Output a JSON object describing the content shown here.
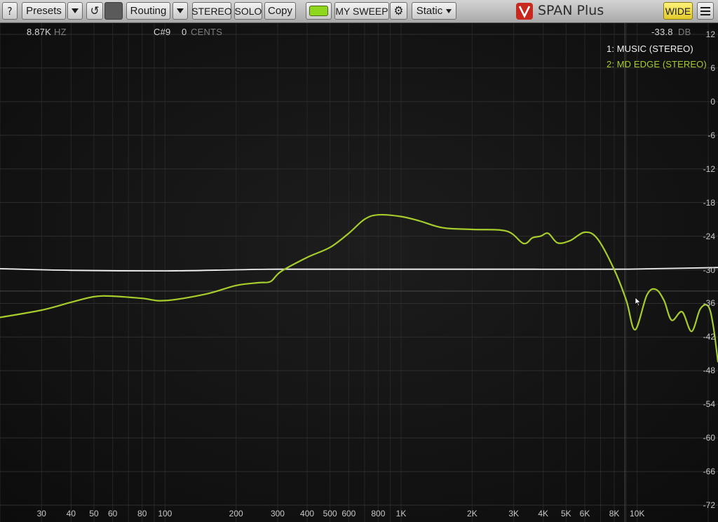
{
  "toolbar": {
    "help_label": "?",
    "presets_label": "Presets",
    "routing_label": "Routing",
    "stereo_label": "STEREO",
    "solo_label": "SOLO",
    "copy_label": "Copy",
    "sweep_label": "MY SWEEP",
    "mode_label": "Static",
    "app_title": "SPAN Plus",
    "wide_label": "WIDE",
    "enable_color": "#8fd61e"
  },
  "info": {
    "freq_value": "8.87K",
    "freq_unit": "HZ",
    "note": "C#9",
    "cents_value": "0",
    "cents_unit": "CENTS",
    "level_value": "-33.8",
    "level_unit": "DB"
  },
  "legend": [
    {
      "label": "1: MUSIC (STEREO)",
      "color": "#f2f2f2"
    },
    {
      "label": "2: MD EDGE (STEREO)",
      "color": "#a6cc2c"
    }
  ],
  "chart_data": {
    "type": "line",
    "x_scale": "log",
    "xlim": [
      20,
      22000
    ],
    "ylim": [
      -75,
      14
    ],
    "x_ticks": [
      {
        "v": 30,
        "label": "30"
      },
      {
        "v": 40,
        "label": "40"
      },
      {
        "v": 50,
        "label": "50"
      },
      {
        "v": 60,
        "label": "60"
      },
      {
        "v": 80,
        "label": "80"
      },
      {
        "v": 100,
        "label": "100"
      },
      {
        "v": 200,
        "label": "200"
      },
      {
        "v": 300,
        "label": "300"
      },
      {
        "v": 400,
        "label": "400"
      },
      {
        "v": 500,
        "label": "500"
      },
      {
        "v": 600,
        "label": "600"
      },
      {
        "v": 800,
        "label": "800"
      },
      {
        "v": 1000,
        "label": "1K"
      },
      {
        "v": 2000,
        "label": "2K"
      },
      {
        "v": 3000,
        "label": "3K"
      },
      {
        "v": 4000,
        "label": "4K"
      },
      {
        "v": 5000,
        "label": "5K"
      },
      {
        "v": 6000,
        "label": "6K"
      },
      {
        "v": 8000,
        "label": "8K"
      },
      {
        "v": 10000,
        "label": "10K"
      }
    ],
    "y_ticks": [
      {
        "v": 12,
        "label": "12"
      },
      {
        "v": 6,
        "label": "6"
      },
      {
        "v": 0,
        "label": "0"
      },
      {
        "v": -6,
        "label": "-6"
      },
      {
        "v": -12,
        "label": "-12"
      },
      {
        "v": -18,
        "label": "-18"
      },
      {
        "v": -24,
        "label": "-24"
      },
      {
        "v": -30,
        "label": "-30"
      },
      {
        "v": -36,
        "label": "-36"
      },
      {
        "v": -42,
        "label": "-42"
      },
      {
        "v": -48,
        "label": "-48"
      },
      {
        "v": -54,
        "label": "-54"
      },
      {
        "v": -60,
        "label": "-60"
      },
      {
        "v": -66,
        "label": "-66"
      },
      {
        "v": -72,
        "label": "-72"
      }
    ],
    "marker_level": -33.8,
    "cursor_freq": 8870,
    "series": [
      {
        "name": "1: MUSIC (STEREO)",
        "color": "#f2f2f2",
        "points": [
          [
            20,
            -29.8
          ],
          [
            40,
            -30.1
          ],
          [
            100,
            -30.2
          ],
          [
            200,
            -30.0
          ],
          [
            300,
            -29.9
          ],
          [
            1000,
            -29.9
          ],
          [
            3000,
            -29.9
          ],
          [
            8000,
            -29.9
          ],
          [
            12000,
            -29.8
          ],
          [
            22000,
            -29.6
          ]
        ]
      },
      {
        "name": "2: MD EDGE (STEREO)",
        "color": "#a6cc2c",
        "points": [
          [
            20,
            -38.5
          ],
          [
            30,
            -37.2
          ],
          [
            40,
            -35.8
          ],
          [
            50,
            -34.8
          ],
          [
            60,
            -34.7
          ],
          [
            80,
            -35.1
          ],
          [
            100,
            -35.5
          ],
          [
            150,
            -34.3
          ],
          [
            200,
            -32.8
          ],
          [
            250,
            -32.3
          ],
          [
            280,
            -32.1
          ],
          [
            310,
            -30.3
          ],
          [
            400,
            -27.8
          ],
          [
            500,
            -26.0
          ],
          [
            600,
            -23.5
          ],
          [
            700,
            -21.0
          ],
          [
            800,
            -20.2
          ],
          [
            1000,
            -20.5
          ],
          [
            1200,
            -21.3
          ],
          [
            1500,
            -22.5
          ],
          [
            2000,
            -22.8
          ],
          [
            2800,
            -23.1
          ],
          [
            3300,
            -25.3
          ],
          [
            3600,
            -24.3
          ],
          [
            3900,
            -24.0
          ],
          [
            4200,
            -23.5
          ],
          [
            4600,
            -25.2
          ],
          [
            5200,
            -24.8
          ],
          [
            6000,
            -23.3
          ],
          [
            6800,
            -24.5
          ],
          [
            8000,
            -30.0
          ],
          [
            9000,
            -35.5
          ],
          [
            9800,
            -40.7
          ],
          [
            11000,
            -34.5
          ],
          [
            12000,
            -33.5
          ],
          [
            13000,
            -35.5
          ],
          [
            14000,
            -39.0
          ],
          [
            15500,
            -37.5
          ],
          [
            17000,
            -41.0
          ],
          [
            18500,
            -37.0
          ],
          [
            20000,
            -36.5
          ],
          [
            21000,
            -40.0
          ],
          [
            22000,
            -46.5
          ]
        ]
      }
    ]
  }
}
